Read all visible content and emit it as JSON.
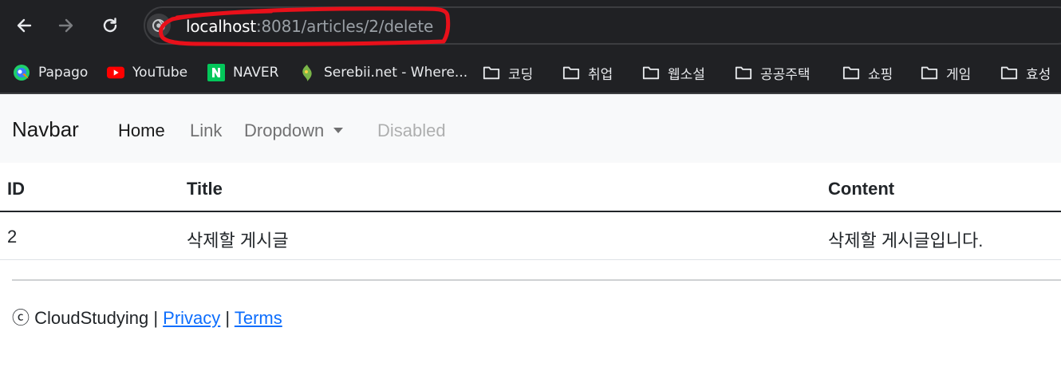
{
  "browser": {
    "url_host": "localhost",
    "url_path": ":8081/articles/2/delete",
    "bookmarks": [
      {
        "label": "Papago",
        "icon": "papago-icon"
      },
      {
        "label": "YouTube",
        "icon": "youtube-icon"
      },
      {
        "label": "NAVER",
        "icon": "naver-icon"
      },
      {
        "label": "Serebii.net - Where...",
        "icon": "serebii-icon"
      },
      {
        "label": "코딩",
        "icon": "folder-icon"
      },
      {
        "label": "취업",
        "icon": "folder-icon"
      },
      {
        "label": "웹소설",
        "icon": "folder-icon"
      },
      {
        "label": "공공주택",
        "icon": "folder-icon"
      },
      {
        "label": "쇼핑",
        "icon": "folder-icon"
      },
      {
        "label": "게임",
        "icon": "folder-icon"
      },
      {
        "label": "효성",
        "icon": "folder-icon"
      }
    ],
    "annotation_color": "#e8101a"
  },
  "navbar": {
    "brand": "Navbar",
    "links": [
      {
        "label": "Home",
        "state": "active"
      },
      {
        "label": "Link",
        "state": "normal"
      },
      {
        "label": "Dropdown",
        "state": "dropdown"
      },
      {
        "label": "Disabled",
        "state": "disabled"
      }
    ]
  },
  "table": {
    "headers": [
      "ID",
      "Title",
      "Content"
    ],
    "rows": [
      [
        "2",
        "삭제할 게시글",
        "삭제할 게시글입니다."
      ]
    ]
  },
  "footer": {
    "copyright": "ⓒ CloudStudying |",
    "separator": "|",
    "privacy": "Privacy",
    "terms": "Terms"
  }
}
